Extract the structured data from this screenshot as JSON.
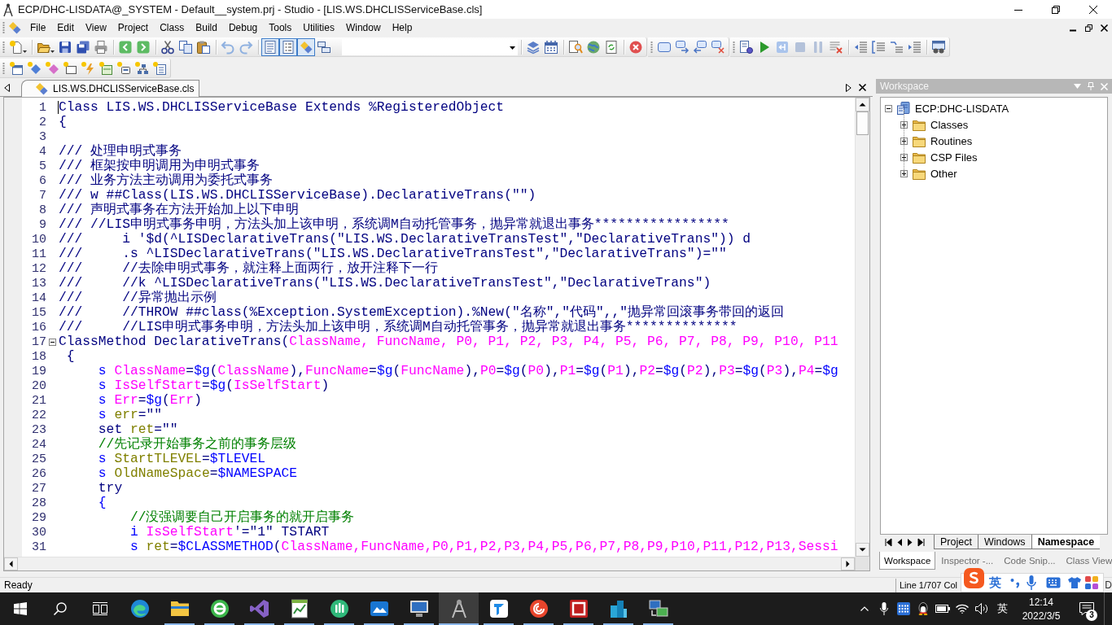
{
  "window": {
    "title": "ECP/DHC-LISDATA@_SYSTEM - Default__system.prj - Studio - [LIS.WS.DHCLISServiceBase.cls]"
  },
  "menu": [
    "File",
    "Edit",
    "View",
    "Project",
    "Class",
    "Build",
    "Debug",
    "Tools",
    "Utilities",
    "Window",
    "Help"
  ],
  "toolbar": {
    "view_toggles": [
      {
        "on": true
      },
      {
        "on": true
      },
      {
        "on": true
      },
      {
        "on": false
      }
    ]
  },
  "document_tabs": [
    {
      "label": "LIS.WS.DHCLISServiceBase.cls",
      "selected": true
    }
  ],
  "editor": {
    "lines": [
      {
        "number": "1",
        "kind": "caret",
        "tokens": [
          {
            "kind": "text",
            "text": "Class LIS.WS.DHCLISServiceBase Extends %RegisteredObject"
          }
        ]
      },
      {
        "number": "2",
        "kind": "code",
        "tokens": [
          {
            "kind": "text",
            "text": "{"
          }
        ]
      },
      {
        "number": "3",
        "kind": "code"
      },
      {
        "number": "4",
        "kind": "code",
        "tokens": [
          {
            "kind": "text",
            "text": "/// 处理申明式事务"
          }
        ]
      },
      {
        "number": "5",
        "kind": "code",
        "tokens": [
          {
            "kind": "text",
            "text": "/// 框架按申明调用为申明式事务"
          }
        ]
      },
      {
        "number": "6",
        "kind": "code",
        "tokens": [
          {
            "kind": "text",
            "text": "/// 业务方法主动调用为委托式事务"
          }
        ]
      },
      {
        "number": "7",
        "kind": "code",
        "tokens": [
          {
            "kind": "text",
            "text": "/// w ##Class(LIS.WS.DHCLISServiceBase).DeclarativeTrans(\"\")"
          }
        ]
      },
      {
        "number": "8",
        "kind": "code",
        "tokens": [
          {
            "kind": "text",
            "text": "/// 声明式事务在方法开始加上以下申明"
          }
        ]
      },
      {
        "number": "9",
        "kind": "code",
        "tokens": [
          {
            "kind": "text",
            "text": "/// //LIS申明式事务申明，方法头加上该申明，系统调M自动托管事务，抛异常就退出事务*****************"
          }
        ]
      },
      {
        "number": "10",
        "kind": "code",
        "tokens": [
          {
            "kind": "text",
            "text": "///     i '$d(^LISDeclarativeTrans(\"LIS.WS.DeclarativeTransTest\",\"DeclarativeTrans\")) d"
          }
        ]
      },
      {
        "number": "11",
        "kind": "code",
        "tokens": [
          {
            "kind": "text",
            "text": "///     .s ^LISDeclarativeTrans(\"LIS.WS.DeclarativeTransTest\",\"DeclarativeTrans\")=\"\""
          }
        ]
      },
      {
        "number": "12",
        "kind": "code",
        "tokens": [
          {
            "kind": "text",
            "text": "///     //去除申明式事务，就注释上面两行，放开注释下一行"
          }
        ]
      },
      {
        "number": "13",
        "kind": "code",
        "tokens": [
          {
            "kind": "text",
            "text": "///     //k ^LISDeclarativeTrans(\"LIS.WS.DeclarativeTransTest\",\"DeclarativeTrans\")"
          }
        ]
      },
      {
        "number": "14",
        "kind": "code",
        "tokens": [
          {
            "kind": "text",
            "text": "///     //异常抛出示例"
          }
        ]
      },
      {
        "number": "15",
        "kind": "code",
        "tokens": [
          {
            "kind": "text",
            "text": "///     //THROW ##class(%Exception.SystemException).%New(\"名称\",\"代码\",,\"抛异常回滚事务带回的返回"
          }
        ]
      },
      {
        "number": "16",
        "kind": "code",
        "tokens": [
          {
            "kind": "text",
            "text": "///     //LIS申明式事务申明，方法头加上该申明，系统调M自动托管事务，抛异常就退出事务**************"
          }
        ]
      },
      {
        "number": "17",
        "kind": "fold",
        "tokens": [
          {
            "kind": "text",
            "text": "ClassMethod DeclarativeTrans("
          },
          {
            "kind": "param",
            "text": "ClassName, FuncName, P0, P1, P2, P3, P4, P5, P6, P7, P8, P9, P10, P11"
          }
        ]
      },
      {
        "number": "18",
        "kind": "code",
        "tokens": [
          {
            "kind": "text",
            "text": " {"
          }
        ]
      },
      {
        "number": "19",
        "kind": "code",
        "tokens": [
          {
            "kind": "command",
            "text": "     s "
          },
          {
            "kind": "param",
            "text": "ClassName"
          },
          {
            "kind": "text",
            "text": "="
          },
          {
            "kind": "command",
            "text": "$g"
          },
          {
            "kind": "text",
            "text": "("
          },
          {
            "kind": "param",
            "text": "ClassName"
          },
          {
            "kind": "text",
            "text": "),"
          },
          {
            "kind": "param",
            "text": "FuncName"
          },
          {
            "kind": "text",
            "text": "="
          },
          {
            "kind": "command",
            "text": "$g"
          },
          {
            "kind": "text",
            "text": "("
          },
          {
            "kind": "param",
            "text": "FuncName"
          },
          {
            "kind": "text",
            "text": "),"
          },
          {
            "kind": "param",
            "text": "P0"
          },
          {
            "kind": "text",
            "text": "="
          },
          {
            "kind": "command",
            "text": "$g"
          },
          {
            "kind": "text",
            "text": "("
          },
          {
            "kind": "param",
            "text": "P0"
          },
          {
            "kind": "text",
            "text": "),"
          },
          {
            "kind": "param",
            "text": "P1"
          },
          {
            "kind": "text",
            "text": "="
          },
          {
            "kind": "command",
            "text": "$g"
          },
          {
            "kind": "text",
            "text": "("
          },
          {
            "kind": "param",
            "text": "P1"
          },
          {
            "kind": "text",
            "text": "),"
          },
          {
            "kind": "param",
            "text": "P2"
          },
          {
            "kind": "text",
            "text": "="
          },
          {
            "kind": "command",
            "text": "$g"
          },
          {
            "kind": "text",
            "text": "("
          },
          {
            "kind": "param",
            "text": "P2"
          },
          {
            "kind": "text",
            "text": "),"
          },
          {
            "kind": "param",
            "text": "P3"
          },
          {
            "kind": "text",
            "text": "="
          },
          {
            "kind": "command",
            "text": "$g"
          },
          {
            "kind": "text",
            "text": "("
          },
          {
            "kind": "param",
            "text": "P3"
          },
          {
            "kind": "text",
            "text": "),"
          },
          {
            "kind": "param",
            "text": "P4"
          },
          {
            "kind": "text",
            "text": "="
          },
          {
            "kind": "command",
            "text": "$g"
          }
        ]
      },
      {
        "number": "20",
        "kind": "code",
        "tokens": [
          {
            "kind": "command",
            "text": "     s "
          },
          {
            "kind": "param",
            "text": "IsSelfStart"
          },
          {
            "kind": "text",
            "text": "="
          },
          {
            "kind": "command",
            "text": "$g"
          },
          {
            "kind": "text",
            "text": "("
          },
          {
            "kind": "param",
            "text": "IsSelfStart"
          },
          {
            "kind": "text",
            "text": ")"
          }
        ]
      },
      {
        "number": "21",
        "kind": "code",
        "tokens": [
          {
            "kind": "command",
            "text": "     s "
          },
          {
            "kind": "param",
            "text": "Err"
          },
          {
            "kind": "text",
            "text": "="
          },
          {
            "kind": "command",
            "text": "$g"
          },
          {
            "kind": "text",
            "text": "("
          },
          {
            "kind": "param",
            "text": "Err"
          },
          {
            "kind": "text",
            "text": ")"
          }
        ]
      },
      {
        "number": "22",
        "kind": "code",
        "tokens": [
          {
            "kind": "command",
            "text": "     s "
          },
          {
            "kind": "local",
            "text": "err"
          },
          {
            "kind": "text",
            "text": "=\"\""
          }
        ]
      },
      {
        "number": "23",
        "kind": "code",
        "tokens": [
          {
            "kind": "text",
            "text": "     set "
          },
          {
            "kind": "local",
            "text": "ret"
          },
          {
            "kind": "text",
            "text": "=\"\""
          }
        ]
      },
      {
        "number": "24",
        "kind": "code",
        "tokens": [
          {
            "kind": "comment",
            "text": "     //先记录开始事务之前的事务层级"
          }
        ]
      },
      {
        "number": "25",
        "kind": "code",
        "tokens": [
          {
            "kind": "command",
            "text": "     s "
          },
          {
            "kind": "local",
            "text": "StartTLEVEL"
          },
          {
            "kind": "text",
            "text": "="
          },
          {
            "kind": "command",
            "text": "$TLEVEL"
          }
        ]
      },
      {
        "number": "26",
        "kind": "code",
        "tokens": [
          {
            "kind": "command",
            "text": "     s "
          },
          {
            "kind": "local",
            "text": "OldNameSpace"
          },
          {
            "kind": "text",
            "text": "="
          },
          {
            "kind": "command",
            "text": "$NAMESPACE"
          }
        ]
      },
      {
        "number": "27",
        "kind": "code",
        "tokens": [
          {
            "kind": "text",
            "text": "     try"
          }
        ]
      },
      {
        "number": "28",
        "kind": "code",
        "tokens": [
          {
            "kind": "command",
            "text": "     {"
          }
        ]
      },
      {
        "number": "29",
        "kind": "code",
        "tokens": [
          {
            "kind": "comment",
            "text": "         //没强调要自己开启事务的就开启事务"
          }
        ]
      },
      {
        "number": "30",
        "kind": "code",
        "tokens": [
          {
            "kind": "command",
            "text": "         i "
          },
          {
            "kind": "param",
            "text": "IsSelfStart"
          },
          {
            "kind": "text",
            "text": "'=\"1\" TSTART"
          }
        ]
      },
      {
        "number": "31",
        "kind": "code",
        "tokens": [
          {
            "kind": "command",
            "text": "         s "
          },
          {
            "kind": "local",
            "text": "ret"
          },
          {
            "kind": "text",
            "text": "="
          },
          {
            "kind": "command",
            "text": "$CLASSMETHOD"
          },
          {
            "kind": "text",
            "text": "("
          },
          {
            "kind": "param",
            "text": "ClassName,FuncName,P0,P1,P2,P3,P4,P5,P6,P7,P8,P9,P10,P11,P12,P13,Sessi"
          }
        ]
      }
    ]
  },
  "workspace": {
    "title": "Workspace",
    "tree": [
      {
        "label": "ECP:DHC-LISDATA",
        "expanded": true,
        "children": [
          {
            "label": "Classes",
            "expanded": false
          },
          {
            "label": "Routines",
            "expanded": false
          },
          {
            "label": "CSP Files",
            "expanded": false
          },
          {
            "label": "Other",
            "expanded": false
          }
        ]
      }
    ],
    "view_tabs": [
      {
        "label": "Project",
        "selected": false
      },
      {
        "label": "Windows",
        "selected": false
      },
      {
        "label": "Namespace",
        "selected": true
      }
    ],
    "panel_tabs": [
      {
        "label": "Workspace",
        "selected": true
      },
      {
        "label": "Inspector -...",
        "selected": false
      },
      {
        "label": "Code Snip...",
        "selected": false
      },
      {
        "label": "Class View",
        "selected": false
      }
    ]
  },
  "status_bar": {
    "message": "Ready",
    "position": "Line 1/707 Col",
    "indicator": "D"
  },
  "input_method": {
    "mode": "英"
  },
  "taskbar": {
    "apps": [
      {
        "running": false,
        "active": false
      },
      {
        "running": true,
        "active": false
      },
      {
        "running": true,
        "active": false
      },
      {
        "running": true,
        "active": false
      },
      {
        "running": true,
        "active": false
      },
      {
        "running": true,
        "active": false
      },
      {
        "running": true,
        "active": false
      },
      {
        "running": true,
        "active": false
      },
      {
        "running": true,
        "active": true
      },
      {
        "running": true,
        "active": false
      },
      {
        "running": true,
        "active": false
      },
      {
        "running": true,
        "active": false
      },
      {
        "running": true,
        "active": false
      },
      {
        "running": true,
        "active": false
      }
    ],
    "language": "英",
    "time": "12:14",
    "date": "2022/3/5",
    "notification_count": "3"
  }
}
